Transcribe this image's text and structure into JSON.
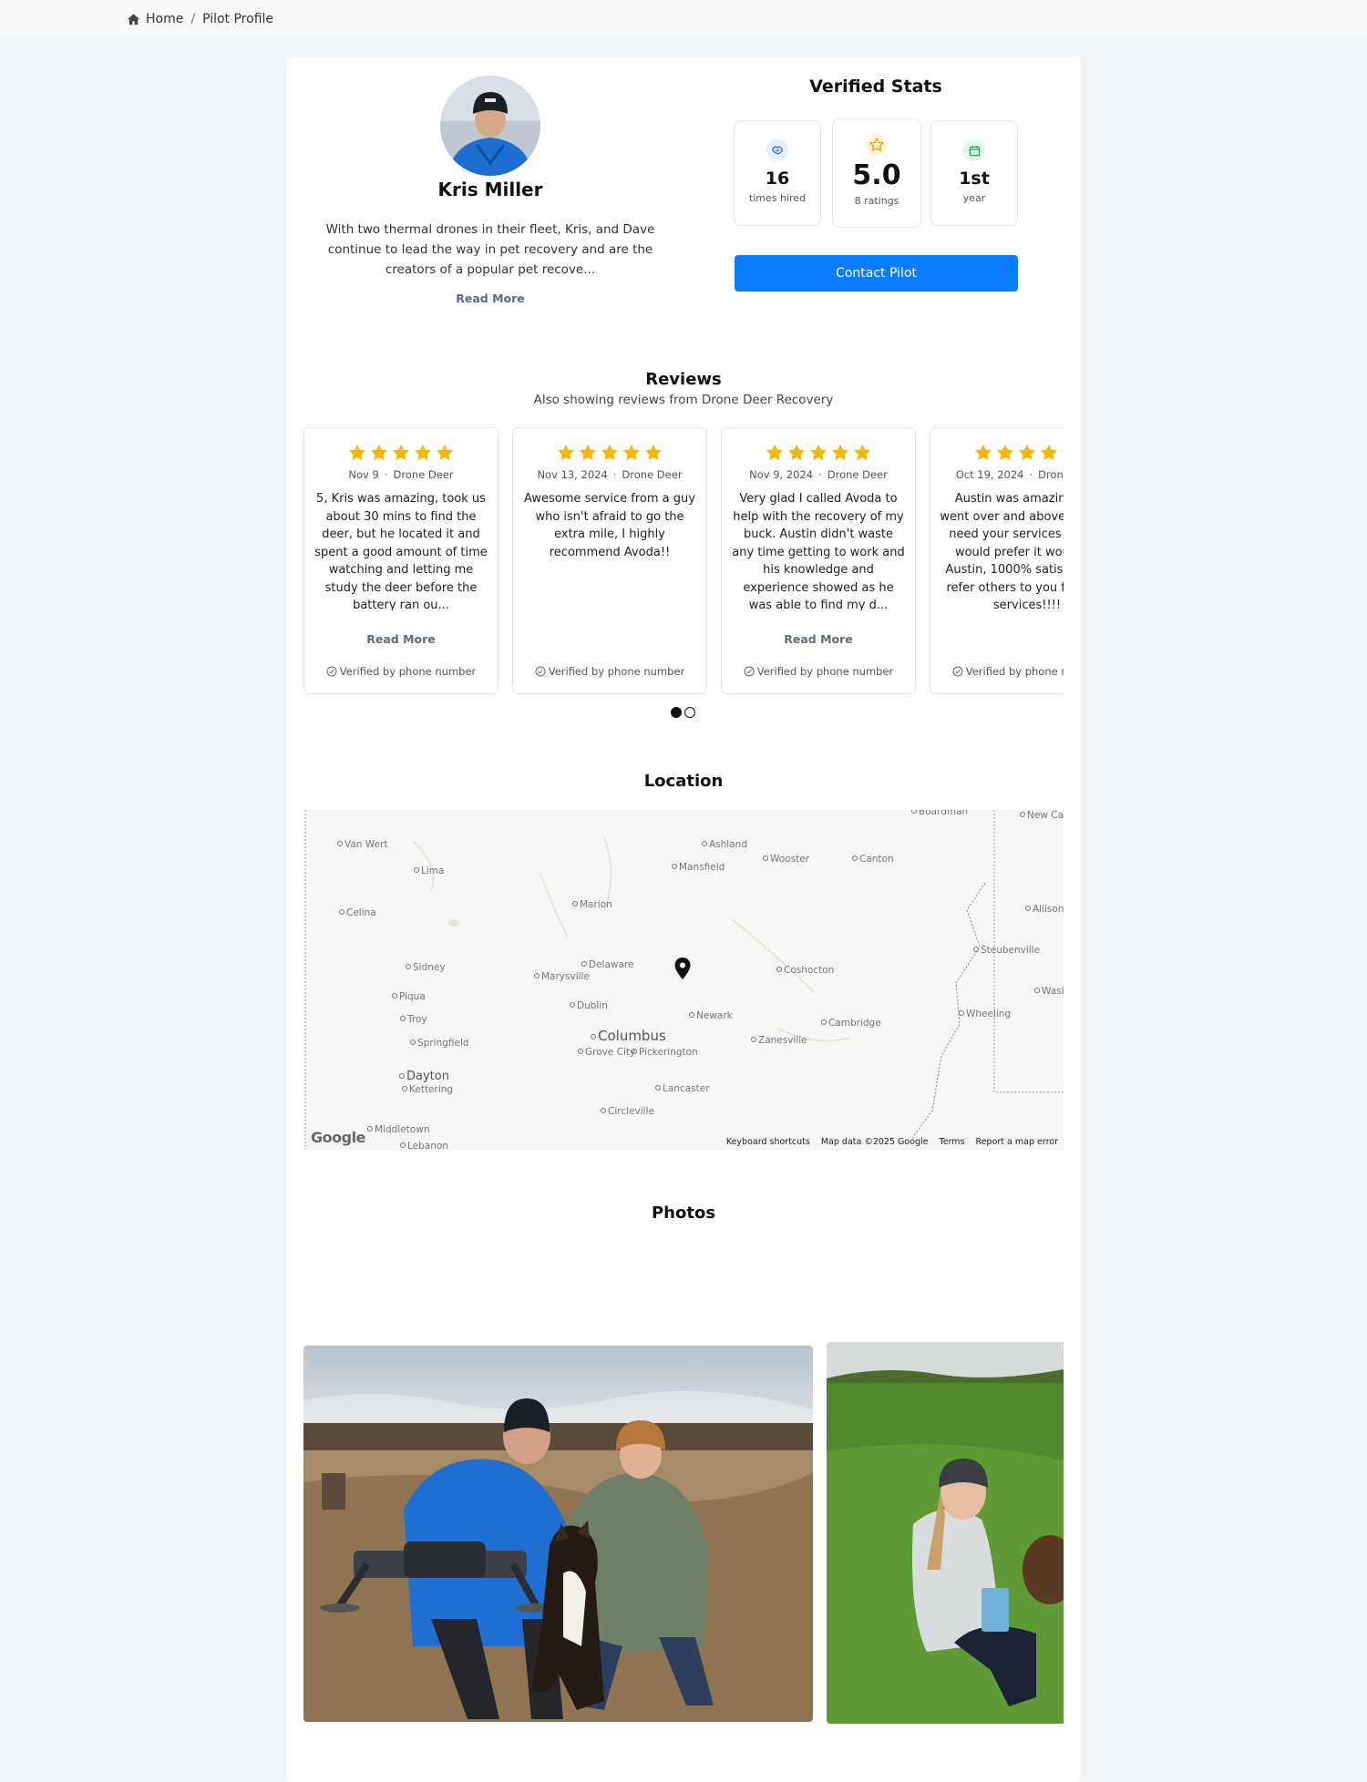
{
  "breadcrumb": {
    "home": "Home",
    "separator": "/",
    "current": "Pilot Profile"
  },
  "profile": {
    "name": "Kris Miller",
    "bio": "With two thermal drones in their fleet, Kris, and Dave continue to lead the way in pet recovery and are the creators of a popular pet recove...",
    "read_more": "Read More"
  },
  "stats": {
    "title": "Verified Stats",
    "hired": {
      "value": "16",
      "caption": "times hired",
      "icon": "handshake-icon"
    },
    "rating": {
      "value": "5.0",
      "caption": "8 ratings",
      "icon": "star-icon"
    },
    "year": {
      "value": "1st",
      "caption": "year",
      "icon": "calendar-icon"
    },
    "contact_label": "Contact Pilot"
  },
  "reviews": {
    "title": "Reviews",
    "subtitle": "Also showing reviews from Drone Deer Recovery",
    "items": [
      {
        "stars": 5,
        "date": "Nov 9",
        "source": "Drone Deer",
        "text": "5, Kris was amazing, took us about 30 mins to find the deer, but he located it and spent a good amount of time watching and letting me study the deer before the battery ran ou...",
        "read_more": "Read More",
        "verified": "Verified by phone number"
      },
      {
        "stars": 5,
        "date": "Nov 13, 2024",
        "source": "Drone Deer",
        "text": "Awesome service from a guy who isn't afraid to go the extra mile, I highly recommend Avoda!!",
        "read_more": "",
        "verified": "Verified by phone number"
      },
      {
        "stars": 5,
        "date": "Nov 9, 2024",
        "source": "Drone Deer",
        "text": "Very glad I called Avoda to help with the recovery of my buck. Austin didn't waste any time getting to work and his knowledge and experience showed as he was able to find my d...",
        "read_more": "Read More",
        "verified": "Verified by phone number"
      },
      {
        "stars": 5,
        "date": "Oct 19, 2024",
        "source": "Drone Deer",
        "text": "Austin was amazing and went over and above if I ever need your services again I would prefer it would be Austin, 1000% satisfied will refer others to you for your services!!!!",
        "read_more": "",
        "verified": "Verified by phone number"
      }
    ],
    "pages": 2,
    "active_page": 0
  },
  "location": {
    "title": "Location",
    "cities": [
      "Van Wert",
      "Lima",
      "Ashland",
      "Mansfield",
      "Wooster",
      "Canton",
      "Marion",
      "Celina",
      "Delaware",
      "Marysville",
      "Sidney",
      "Coshocton",
      "Steubenville",
      "Piqua",
      "Dublin",
      "Newark",
      "Troy",
      "Columbus",
      "Zanesville",
      "Cambridge",
      "Wheeling",
      "Springfield",
      "Grove City",
      "Pickerington",
      "Dayton",
      "Kettering",
      "Lancaster",
      "Circleville",
      "Middletown",
      "Lebanon",
      "Allison P",
      "New Ca",
      "Boardman",
      "Wasl"
    ],
    "google": "Google",
    "attribution": [
      "Keyboard shortcuts",
      "Map data ©2025 Google",
      "Terms",
      "Report a map error"
    ]
  },
  "photos": {
    "title": "Photos"
  },
  "colors": {
    "accent": "#0a7cff",
    "star": "#f5b50a",
    "background": "#f1f4f8"
  }
}
